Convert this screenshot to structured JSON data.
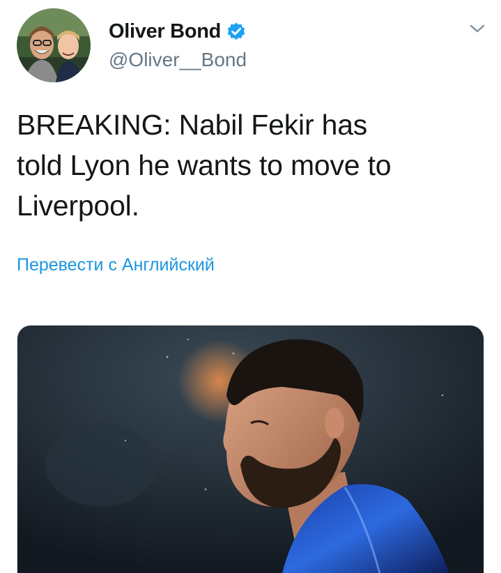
{
  "tweet": {
    "author": {
      "display_name": "Oliver Bond",
      "handle": "@Oliver__Bond",
      "verified": true,
      "avatar_icon": "profile-photo"
    },
    "menu_icon": "chevron-down-icon",
    "text_lines": [
      "BREAKING: Nabil Fekir has",
      "told Lyon he wants to move to",
      "Liverpool."
    ],
    "translate_label": "Перевести с Английский",
    "media": {
      "type": "photo"
    }
  },
  "colors": {
    "link_blue": "#1b95e0",
    "verified_blue": "#1da1f2",
    "secondary_text": "#657786",
    "primary_text": "#14171a"
  }
}
